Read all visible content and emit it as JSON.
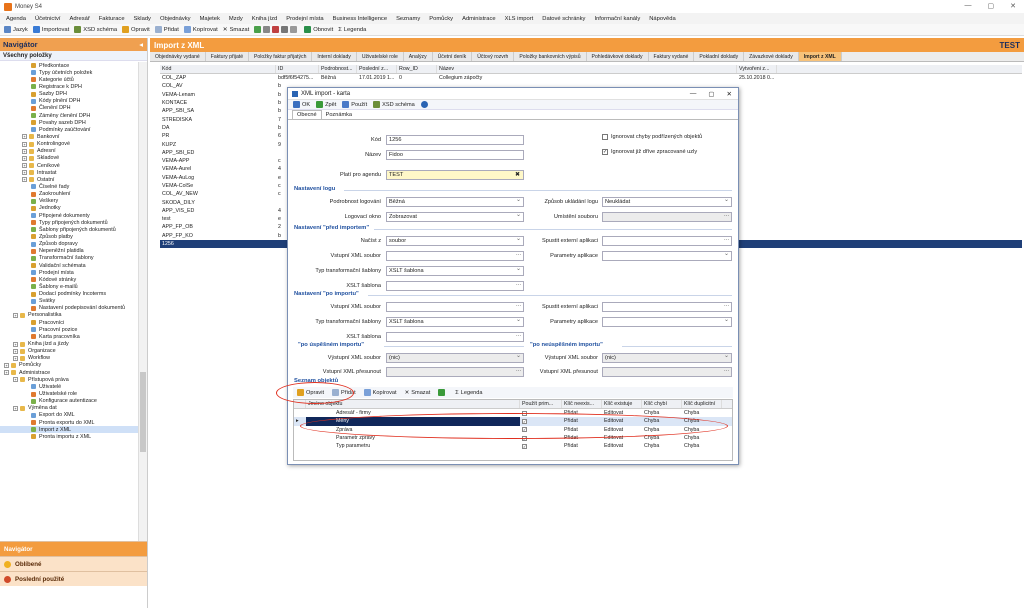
{
  "app": {
    "title": "Money S4"
  },
  "menu": [
    "Agenda",
    "Účetnictví",
    "Adresář",
    "Fakturace",
    "Sklady",
    "Objednávky",
    "Majetek",
    "Mzdy",
    "Kniha jízd",
    "Prodejní místa",
    "Business Intelligence",
    "Seznamy",
    "Pomůcky",
    "Administrace",
    "XLS import",
    "Datové schránky",
    "Informační kanály",
    "Nápověda"
  ],
  "toolbar": {
    "jazyk": "Jazyk",
    "importovat": "Importovat",
    "xsd": "XSD schéma",
    "opravit": "Opravit",
    "pridat": "Přidat",
    "kopirovat": "Kopírovat",
    "smazat": "Smazat",
    "obnovit": "Obnovit",
    "legenda": "Legenda"
  },
  "navigator": {
    "title": "Navigátor",
    "subtitle": "Všechny položky",
    "tree": [
      {
        "label": "Předkontace",
        "lvl": 3
      },
      {
        "label": "Typy účetních položek",
        "lvl": 3
      },
      {
        "label": "Kategorie účtů",
        "lvl": 3
      },
      {
        "label": "Registrace k DPH",
        "lvl": 3
      },
      {
        "label": "Sazby DPH",
        "lvl": 3
      },
      {
        "label": "Kódy plnění DPH",
        "lvl": 3
      },
      {
        "label": "Členění DPH",
        "lvl": 3
      },
      {
        "label": "Záměny členění DPH",
        "lvl": 3
      },
      {
        "label": "Povahy sazeb DPH",
        "lvl": 3
      },
      {
        "label": "Podmínky zaúčtování",
        "lvl": 3
      },
      {
        "label": "Bankovní",
        "lvl": 2
      },
      {
        "label": "Kontrolingové",
        "lvl": 2
      },
      {
        "label": "Adresní",
        "lvl": 2
      },
      {
        "label": "Skladové",
        "lvl": 2
      },
      {
        "label": "Ceníkové",
        "lvl": 2
      },
      {
        "label": "Intrastat",
        "lvl": 2
      },
      {
        "label": "Ostatní",
        "lvl": 2
      },
      {
        "label": "Číselné řady",
        "lvl": 3
      },
      {
        "label": "Zaokrouhlení",
        "lvl": 3
      },
      {
        "label": "Veškery",
        "lvl": 3
      },
      {
        "label": "Jednotky",
        "lvl": 3
      },
      {
        "label": "Připojené dokumenty",
        "lvl": 3
      },
      {
        "label": "Typy připojených dokumentů",
        "lvl": 3
      },
      {
        "label": "Šablony připojených dokumentů",
        "lvl": 3
      },
      {
        "label": "Způsob platby",
        "lvl": 3
      },
      {
        "label": "Způsob dopravy",
        "lvl": 3
      },
      {
        "label": "Nepeněžní platidla",
        "lvl": 3
      },
      {
        "label": "Transformační šablony",
        "lvl": 3
      },
      {
        "label": "Validační schémata",
        "lvl": 3
      },
      {
        "label": "Prodejní místa",
        "lvl": 3
      },
      {
        "label": "Kódové stránky",
        "lvl": 3
      },
      {
        "label": "Šablony e-mailů",
        "lvl": 3
      },
      {
        "label": "Dodací podmínky Incoterms",
        "lvl": 3
      },
      {
        "label": "Svátky",
        "lvl": 3
      },
      {
        "label": "Nastavení podepisování dokumentů",
        "lvl": 3
      },
      {
        "label": "Personalistika",
        "lvl": 1
      },
      {
        "label": "Pracovníci",
        "lvl": 3
      },
      {
        "label": "Pracovní pozice",
        "lvl": 3
      },
      {
        "label": "Karta pracovníka",
        "lvl": 3
      },
      {
        "label": "Kniha jízd a jízdy",
        "lvl": 1
      },
      {
        "label": "Organizace",
        "lvl": 1
      },
      {
        "label": "Workflow",
        "lvl": 1
      },
      {
        "label": "Pomůcky",
        "lvl": 0
      },
      {
        "label": "Administrace",
        "lvl": 0
      },
      {
        "label": "Přístupová práva",
        "lvl": 1
      },
      {
        "label": "Uživatelé",
        "lvl": 3
      },
      {
        "label": "Uživatelské role",
        "lvl": 3
      },
      {
        "label": "Konfigurace autentizace",
        "lvl": 3
      },
      {
        "label": "Výměna dat",
        "lvl": 1
      },
      {
        "label": "Export do XML",
        "lvl": 3
      },
      {
        "label": "Pronta exportu do XML",
        "lvl": 3
      },
      {
        "label": "Import z XML",
        "lvl": 3,
        "sel": true
      },
      {
        "label": "Pronta importu z XML",
        "lvl": 3
      }
    ],
    "bottom": [
      "Navigátor",
      "Oblíbené",
      "Poslední použité"
    ]
  },
  "main": {
    "title": "Import z XML",
    "company": "TEST",
    "tabs": [
      "Objednávky vydané",
      "Faktury přijaté",
      "Položky faktur přijatých",
      "Interní doklady",
      "Uživatelské role",
      "Analýzy",
      "Účetní deník",
      "Účtový rozvrh",
      "Položky bankovních výpisů",
      "Pohledávkové doklady",
      "Faktury vydané",
      "Pokladní doklady",
      "Závazkové doklady",
      "Import z XML"
    ],
    "columns": [
      "Kód",
      "ID",
      "Podrobnost...",
      "Poslední z...",
      "Row_ID",
      "Název",
      "Vytvořeni z..."
    ],
    "rows": [
      [
        "COL_ZAP",
        "bdf5f6f54275...",
        "Běžná",
        "17.01.2019 1...",
        "0",
        "Collegium zápočty",
        "25.10.2018 0..."
      ],
      [
        "COL_AV",
        "b",
        "",
        "",
        "",
        "",
        ""
      ],
      [
        "VEMA-Lenam",
        "b",
        "",
        "",
        "",
        "",
        ""
      ],
      [
        "KONTACE",
        "b",
        "",
        "",
        "",
        "",
        ""
      ],
      [
        "APP_SBI_SA",
        "b",
        "",
        "",
        "",
        "",
        ""
      ],
      [
        "STREDISKA",
        "7",
        "",
        "",
        "",
        "",
        ""
      ],
      [
        "DA",
        "b",
        "",
        "",
        "",
        "",
        ""
      ],
      [
        "PR",
        "6",
        "",
        "",
        "",
        "",
        ""
      ],
      [
        "KUPZ",
        "9",
        "",
        "",
        "",
        "",
        ""
      ],
      [
        "APP_SBI_ED",
        "",
        "",
        "",
        "",
        "",
        ""
      ],
      [
        "VEMA-APP",
        "c",
        "",
        "",
        "",
        "",
        ""
      ],
      [
        "VEMA-Aurel",
        "4",
        "",
        "",
        "",
        "",
        ""
      ],
      [
        "VEMA-AuLog",
        "e",
        "",
        "",
        "",
        "",
        ""
      ],
      [
        "VEMA-ColSe",
        "c",
        "",
        "",
        "",
        "",
        ""
      ],
      [
        "COL_AV_NEW",
        "c",
        "",
        "",
        "",
        "",
        ""
      ],
      [
        "SKODA_DILY",
        "",
        "",
        "",
        "",
        "",
        ""
      ],
      [
        "APP_VIS_ED",
        "4",
        "",
        "",
        "",
        "",
        ""
      ],
      [
        "test",
        "e",
        "",
        "",
        "",
        "",
        ""
      ],
      [
        "APP_FP_OB",
        "2",
        "",
        "",
        "",
        "",
        ""
      ],
      [
        "APP_FP_KO",
        "b",
        "",
        "",
        "",
        "",
        ""
      ],
      [
        "1256",
        "",
        "",
        "",
        "",
        "",
        ""
      ]
    ]
  },
  "dialog": {
    "title": "XML import - karta",
    "toolbar": {
      "ok": "OK",
      "zpet": "Zpět",
      "pouzit": "Použít",
      "xsd": "XSD schéma"
    },
    "tabs": [
      "Obecné",
      "Poznámka"
    ],
    "kod_label": "Kód",
    "kod": "1256",
    "nazev_label": "Název",
    "nazev": "Fidoo",
    "agenda_label": "Platí pro agendu",
    "agenda": "TEST",
    "chk1": "Ignorovat chyby podřízených objektů",
    "chk2": "Ignorovat již dříve zpracované uzly",
    "sec_log": "Nastavení logu",
    "podrobnost_label": "Podrobnost logování",
    "podrobnost": "Běžná",
    "zpusob_label": "Způsob ukládání logu",
    "zpusob": "Neukládat",
    "okno_label": "Logovací okno",
    "okno": "Zobrazovat",
    "umisteni_label": "Umístění souboru",
    "sec_pred": "Nastavení \"před importem\"",
    "nacist_label": "Načíst z",
    "nacist": "soubor",
    "spustit_label": "Spustit externí aplikaci",
    "vstupni_label": "Vstupní XML soubor",
    "parametry_label": "Parametry aplikace",
    "typ_label": "Typ transformační šablony",
    "typ": "XSLT šablona",
    "xslt_label": "XSLT šablona",
    "sec_po": "Nastavení \"po importu\"",
    "sec_uspesny": "\"po úspěšném importu\"",
    "sec_neuspesny": "\"po neúspěšném importu\"",
    "vystupni_label": "Výstupní XML soubor",
    "nic": "(nic)",
    "presunout_label": "Vstupní XML přesunout",
    "sec_objekty": "Seznam objektů",
    "sub_toolbar": {
      "opravit": "Opravit",
      "pridat": "Přidat",
      "kopirovat": "Kopírovat",
      "smazat": "Smazat",
      "legenda": "Legenda"
    },
    "sub_columns": [
      "Jméno objektu",
      "Použít prim...",
      "Klíč neexis...",
      "Klíč existuje",
      "Klíč chybí",
      "Klíč duplicitní"
    ],
    "sub_rows": [
      [
        "Adresář - firmy",
        "",
        "Přidat",
        "Editovat",
        "Chyba",
        "Chyba"
      ],
      [
        "Měny",
        "✓",
        "Přidat",
        "Editovat",
        "Chyba",
        "Chyba"
      ],
      [
        "Zpráva",
        "✓",
        "Přidat",
        "Editovat",
        "Chyba",
        "Chyba"
      ],
      [
        "Parametr zprávy",
        "✓",
        "Přidat",
        "Editovat",
        "Chyba",
        "Chyba"
      ],
      [
        "Typ parametru",
        "✓",
        "Přidat",
        "Editovat",
        "Chyba",
        "Chyba"
      ]
    ]
  },
  "colors": {
    "accent": "#f39c3f",
    "selection": "#1f3f78",
    "highlight": "#e03020"
  }
}
